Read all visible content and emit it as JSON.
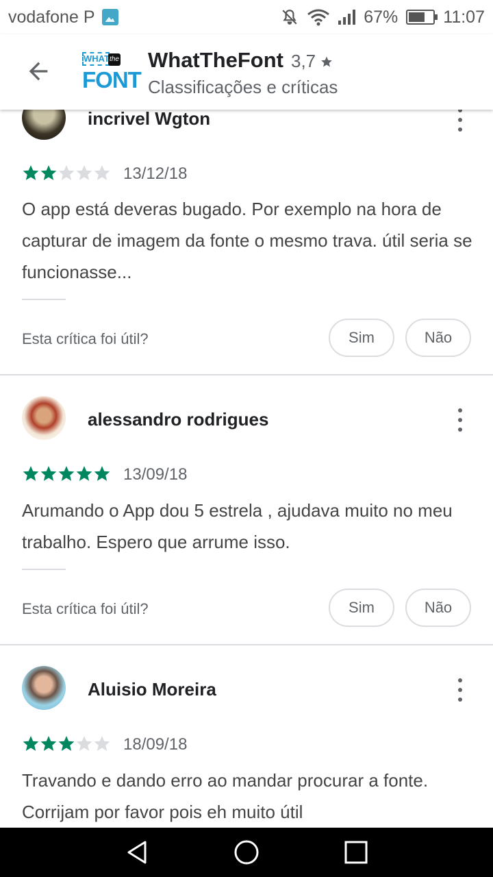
{
  "status": {
    "carrier": "vodafone P",
    "battery": "67%",
    "battery_level": 0.67,
    "time": "11:07",
    "icons": [
      "gallery-icon",
      "mute-icon",
      "wifi-icon",
      "signal-icon",
      "battery-icon"
    ]
  },
  "header": {
    "app_name": "WhatTheFont",
    "rating": "3,7",
    "subtitle": "Classificações e críticas",
    "logo_top": "WHAT",
    "logo_mid": "the",
    "logo_bottom": "FONT"
  },
  "colors": {
    "star_filled": "#01875f",
    "star_empty": "#dadce0"
  },
  "reviews": [
    {
      "name": "incrivel Wgton",
      "stars": 2,
      "date": "13/12/18",
      "text": "O app está deveras bugado. Por exemplo na hora de capturar de imagem da fonte o mesmo trava. útil seria se funcionasse...",
      "helpful_question": "Esta crítica foi útil?",
      "yes": "Sim",
      "no": "Não"
    },
    {
      "name": "alessandro rodrigues",
      "stars": 5,
      "date": "13/09/18",
      "text": "Arumando o App dou 5 estrela , ajudava muito no meu trabalho. Espero que arrume isso.",
      "helpful_question": "Esta crítica foi útil?",
      "yes": "Sim",
      "no": "Não"
    },
    {
      "name": "Aluisio Moreira",
      "stars": 3,
      "date": "18/09/18",
      "text": "Travando e dando erro ao mandar procurar a fonte. Corrijam por favor pois eh muito útil"
    }
  ],
  "nav": [
    "back-icon",
    "home-icon",
    "recents-icon"
  ]
}
